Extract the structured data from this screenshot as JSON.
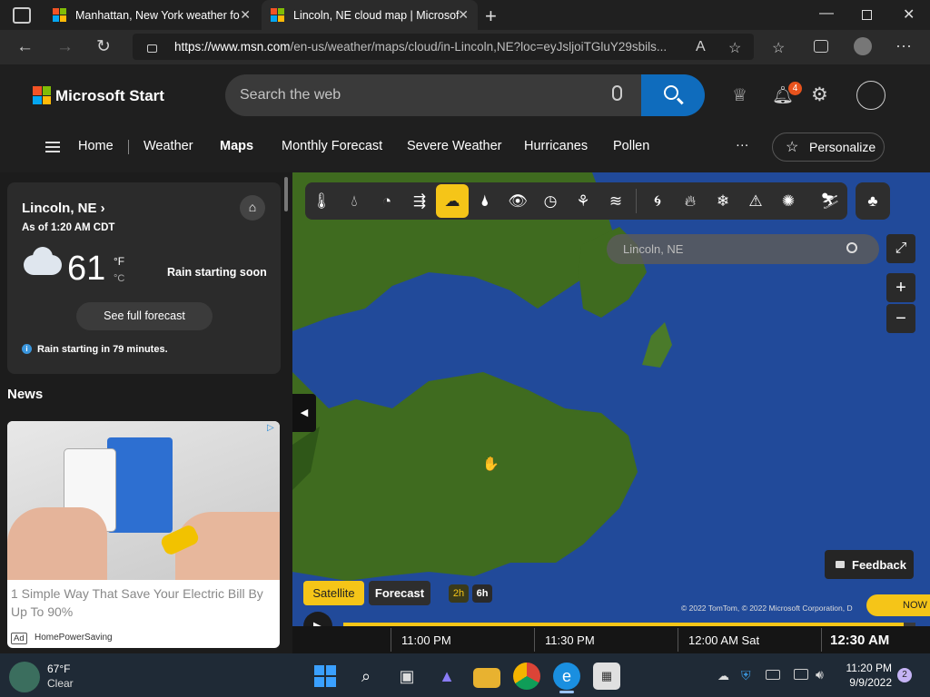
{
  "browser": {
    "tabs": [
      {
        "title": "Manhattan, New York weather fo",
        "active": false
      },
      {
        "title": "Lincoln, NE cloud map | Microsof",
        "active": true
      }
    ],
    "url_domain": "https://www.msn.com",
    "url_path": "/en-us/weather/maps/cloud/in-Lincoln,NE?loc=eyJsljoiTGluY29sbils..."
  },
  "header": {
    "logo_text": "Microsoft Start",
    "search_placeholder": "Search the web",
    "notification_count": "4",
    "nav": [
      "Home",
      "Weather",
      "Maps",
      "Monthly Forecast",
      "Severe Weather",
      "Hurricanes",
      "Pollen"
    ],
    "personalize_label": "Personalize",
    "more_label": "···"
  },
  "weather_card": {
    "location": "Lincoln, NE",
    "as_of": "As of 1:20 AM CDT",
    "temperature": "61",
    "unit_f": "°F",
    "unit_c": "°C",
    "condition": "Rain starting soon",
    "full_forecast_label": "See full forecast",
    "alert": "Rain starting in 79 minutes."
  },
  "news": {
    "heading": "News",
    "ad_title": "1 Simple Way That Save Your Electric Bill By Up To 90%",
    "ad_badge": "Ad",
    "ad_source": "HomePowerSaving"
  },
  "map": {
    "location_search": "Lincoln, NE",
    "feedback_label": "Feedback",
    "mode_satellite": "Satellite",
    "mode_forecast": "Forecast",
    "range_2h": "2h",
    "range_6h": "6h",
    "copyright": "© 2022 TomTom, © 2022 Microsoft Corporation, D",
    "now_label": "NOW",
    "times": [
      "11:00 PM",
      "11:30 PM",
      "12:00 AM Sat",
      "12:30 AM"
    ],
    "progress": 0.98
  },
  "taskbar": {
    "weather_temp": "67°F",
    "weather_cond": "Clear",
    "time": "11:20 PM",
    "date": "9/9/2022",
    "notif_count": "2"
  },
  "colors": {
    "accent_blue": "#0f6cbd",
    "active_tool": "#f5c518",
    "map_water": "#214a9a",
    "map_land": "#3f6b1f"
  }
}
